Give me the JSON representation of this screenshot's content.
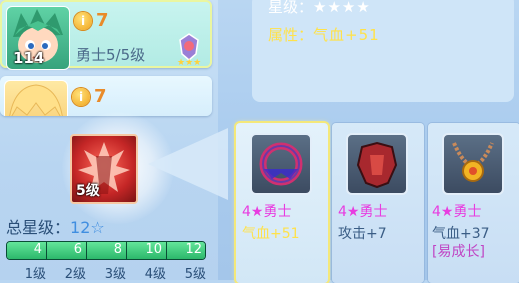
{
  "heroes": [
    {
      "star_count": "7",
      "subtitle": "勇士5/5级",
      "level": "114"
    },
    {
      "star_count": "7"
    }
  ],
  "info": {
    "star_label": "星级：",
    "star_value": "★★★★",
    "attr_label": "属性：",
    "attr_value": "气血+51"
  },
  "skill": {
    "level": "5级"
  },
  "equipment": [
    {
      "name": "4★勇士",
      "stat": "气血+51"
    },
    {
      "name": "4★勇士",
      "stat": "攻击+7"
    },
    {
      "name": "4★勇士",
      "stat": "气血+37",
      "tag": "[易成长]"
    }
  ],
  "total": {
    "label": "总星级：",
    "value": "12",
    "value_icon": "star-icon",
    "progress": 1.0,
    "ticks": [
      "4",
      "6",
      "8",
      "10",
      "12"
    ],
    "grades": [
      "1级",
      "2级",
      "3级",
      "4级",
      "5级"
    ]
  },
  "colors": {
    "accent_yellow": "#ffe24a",
    "equip_name_magenta": "#e83ce0",
    "progress_green": "#2cb86b"
  }
}
